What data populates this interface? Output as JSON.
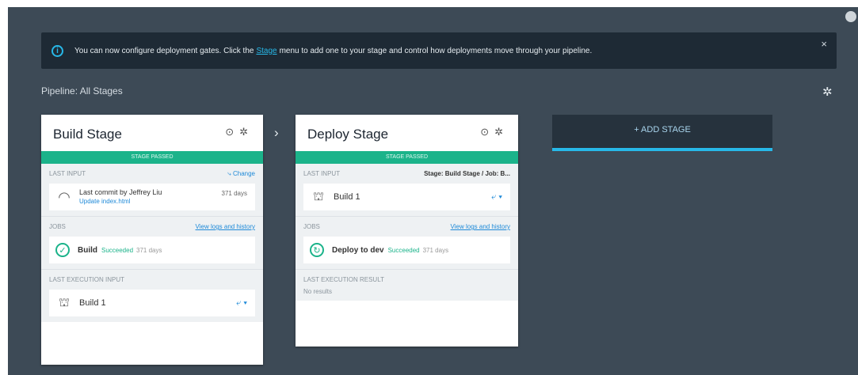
{
  "banner": {
    "info_icon": "info-icon",
    "text_before": "You can now configure deployment gates. Click the",
    "link": "Stage",
    "text_after": "menu to add one to your stage and control how deployments move through your pipeline.",
    "close": "×"
  },
  "pipeline": {
    "label": "Pipeline: All Stages",
    "settings_icon": "gear-icon"
  },
  "stages": [
    {
      "title": "Build Stage",
      "status": "STAGE PASSED",
      "input": {
        "label": "LAST INPUT",
        "link": "Change",
        "commit_text": "Last commit by Jeffrey Liu",
        "commit_sub": "Update index.html",
        "age": "371 days"
      },
      "jobs": {
        "label": "JOBS",
        "link": "View logs and history",
        "name": "Build",
        "status": "Succeeded",
        "age": "371 days"
      },
      "last_execution": {
        "label": "LAST EXECUTION INPUT",
        "build": "Build 1",
        "dropdown": "⤶ ▾"
      }
    },
    {
      "title": "Deploy Stage",
      "status": "STAGE PASSED",
      "input": {
        "label": "LAST INPUT",
        "source": "Stage: Build Stage / Job: B...",
        "build": "Build 1",
        "dropdown": "⤶ ▾"
      },
      "jobs": {
        "label": "JOBS",
        "link": "View logs and history",
        "name": "Deploy to dev",
        "status": "Succeeded",
        "age": "371 days"
      },
      "last_execution": {
        "label": "LAST EXECUTION RESULT",
        "value": "No results"
      }
    }
  ],
  "add_stage": {
    "label": "+ ADD STAGE"
  },
  "colors": {
    "background": "#3d4a56",
    "banner": "#1e2a35",
    "accent": "#27b8e8",
    "success": "#1bb38a"
  }
}
